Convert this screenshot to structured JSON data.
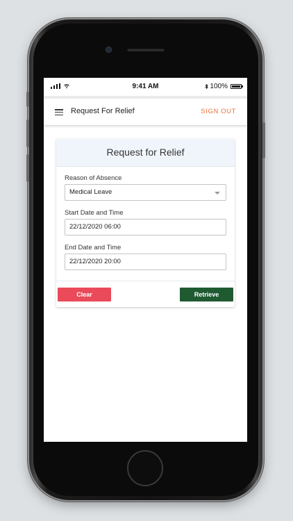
{
  "status_bar": {
    "time": "9:41 AM",
    "battery_percent": "100%"
  },
  "app_bar": {
    "title": "Request For Relief",
    "sign_out_label": "SIGN OUT",
    "menu_icon": "hamburger-icon"
  },
  "form": {
    "title": "Request for Relief",
    "reason": {
      "label": "Reason of Absence",
      "value": "Medical Leave"
    },
    "start": {
      "label": "Start Date and Time",
      "value": "22/12/2020 06:00"
    },
    "end": {
      "label": "End Date and Time",
      "value": "22/12/2020 20:00"
    },
    "clear_label": "Clear",
    "retrieve_label": "Retrieve"
  },
  "colors": {
    "accent_sign_out": "#e8703a",
    "clear_button": "#ea4a5a",
    "retrieve_button": "#1f5a31",
    "card_header": "#f0f5fb",
    "background": "#dde1e4"
  }
}
